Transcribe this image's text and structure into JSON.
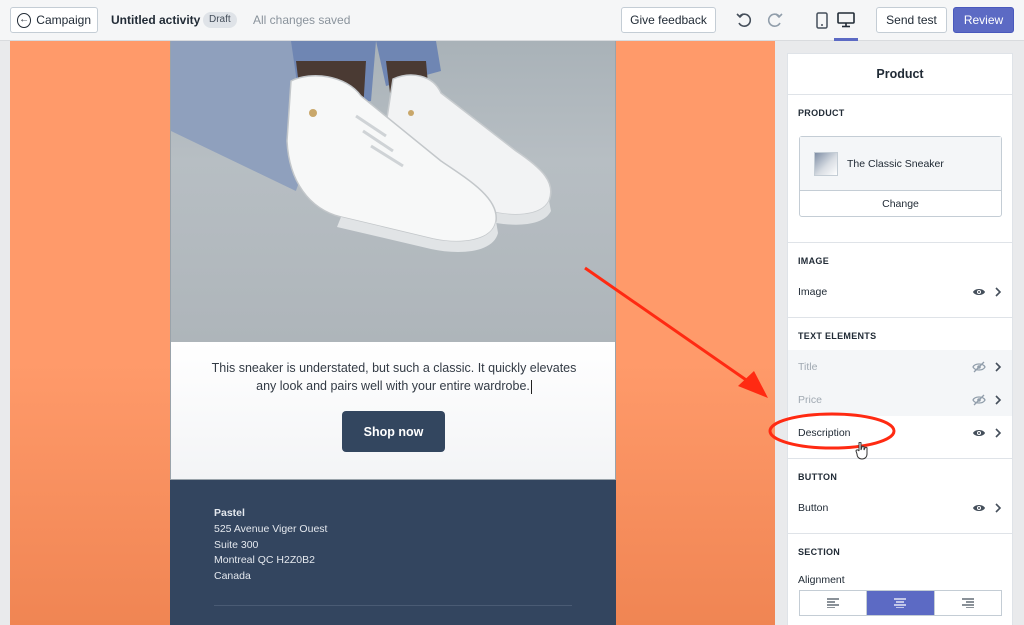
{
  "topbar": {
    "back_label": "Campaign",
    "activity_title": "Untitled activity",
    "status_badge": "Draft",
    "save_status": "All changes saved",
    "feedback_label": "Give feedback",
    "send_test_label": "Send test",
    "review_label": "Review"
  },
  "email": {
    "description": "This sneaker is understated, but such a classic. It quickly elevates any look and pairs well with your entire wardrobe.",
    "button_label": "Shop now",
    "footer": {
      "company": "Pastel",
      "address_line1": "525 Avenue Viger Ouest",
      "address_line2": "Suite 300",
      "address_line3": "Montreal QC H2Z0B2",
      "address_line4": "Canada"
    }
  },
  "panel": {
    "title": "Product",
    "product_section": {
      "label": "PRODUCT",
      "product_name": "The Classic Sneaker",
      "change_label": "Change"
    },
    "image_section": {
      "label": "IMAGE",
      "image_label": "Image"
    },
    "text_section": {
      "label": "TEXT ELEMENTS",
      "items": [
        {
          "label": "Title",
          "visible": false
        },
        {
          "label": "Price",
          "visible": false
        },
        {
          "label": "Description",
          "visible": true
        }
      ]
    },
    "button_section": {
      "label": "BUTTON",
      "button_label": "Button"
    },
    "section_section": {
      "label": "SECTION",
      "alignment_label": "Alignment",
      "alignment_options": [
        "left",
        "center",
        "right"
      ],
      "alignment_selected": "center"
    }
  },
  "colors": {
    "accent": "#5c6ac4",
    "canvas_background": "#ff9a6a",
    "footer_background": "#33455f",
    "shop_button": "#33465f",
    "annotation": "#ff2a12"
  }
}
